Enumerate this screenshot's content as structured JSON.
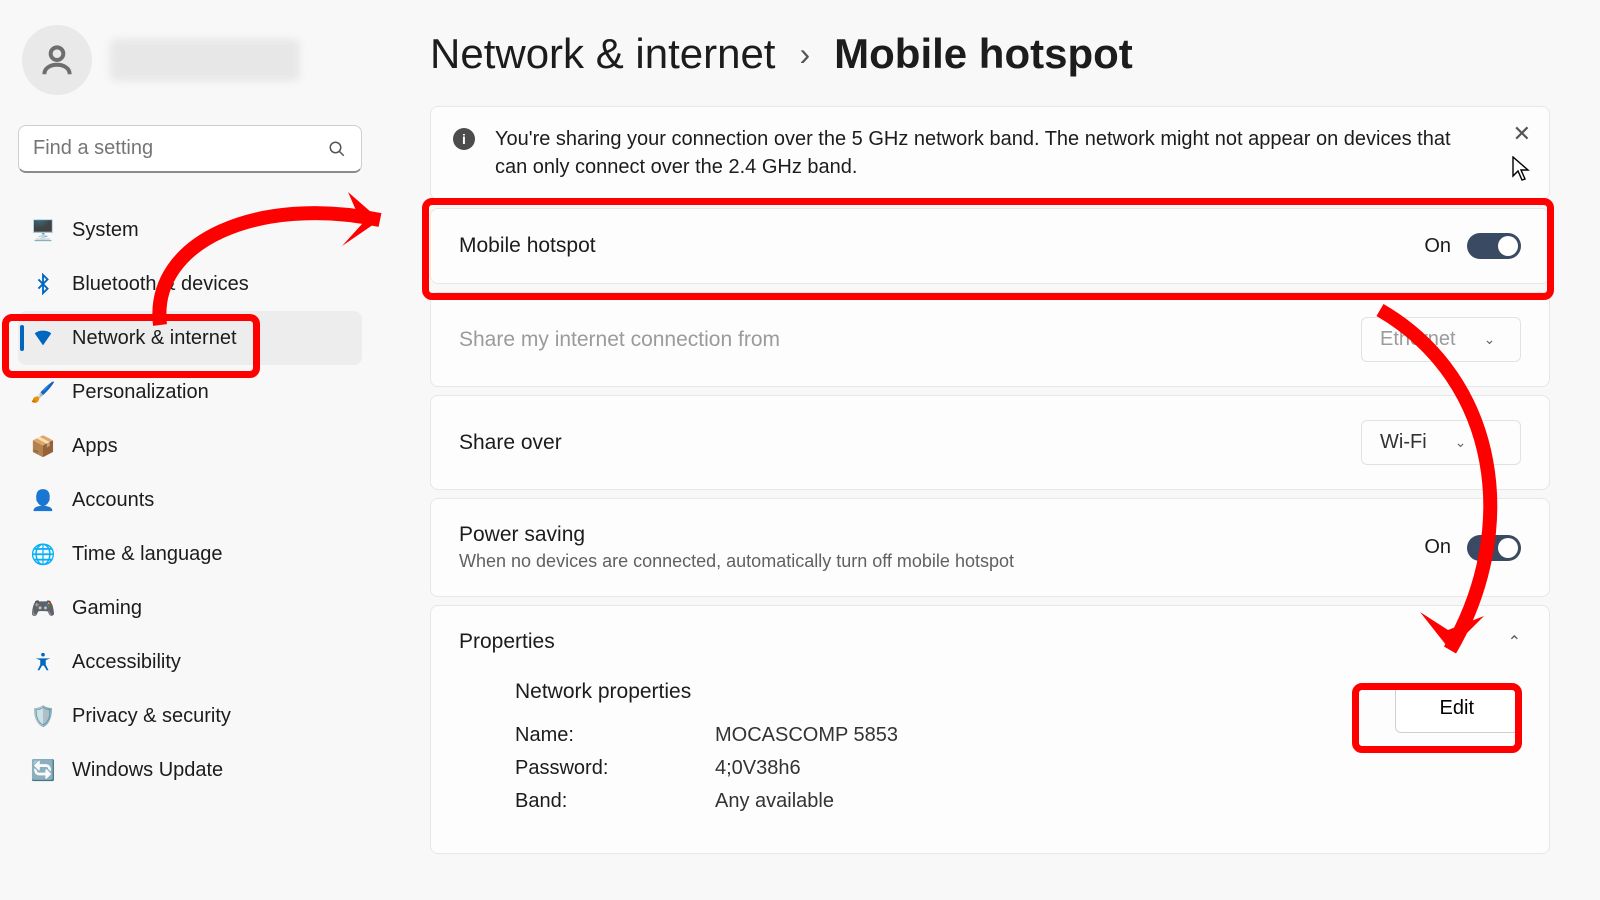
{
  "search": {
    "placeholder": "Find a setting"
  },
  "nav": {
    "items": [
      {
        "label": "System",
        "icon": "🖥️",
        "name": "nav-system"
      },
      {
        "label": "Bluetooth & devices",
        "icon": "",
        "name": "nav-bluetooth"
      },
      {
        "label": "Network & internet",
        "icon": "",
        "name": "nav-network",
        "active": true
      },
      {
        "label": "Personalization",
        "icon": "🖌️",
        "name": "nav-personalization"
      },
      {
        "label": "Apps",
        "icon": "📦",
        "name": "nav-apps"
      },
      {
        "label": "Accounts",
        "icon": "👤",
        "name": "nav-accounts"
      },
      {
        "label": "Time & language",
        "icon": "🌐",
        "name": "nav-time-language"
      },
      {
        "label": "Gaming",
        "icon": "🎮",
        "name": "nav-gaming"
      },
      {
        "label": "Accessibility",
        "icon": "",
        "name": "nav-accessibility"
      },
      {
        "label": "Privacy & security",
        "icon": "🛡️",
        "name": "nav-privacy"
      },
      {
        "label": "Windows Update",
        "icon": "🔄",
        "name": "nav-update"
      }
    ]
  },
  "breadcrumb": {
    "parent": "Network & internet",
    "sep": "›",
    "leaf": "Mobile hotspot"
  },
  "info": {
    "text": "You're sharing your connection over the 5 GHz network band. The network might not appear on devices that can only connect over the 2.4 GHz band."
  },
  "hotspot": {
    "label": "Mobile hotspot",
    "state": "On"
  },
  "share_from": {
    "label": "Share my internet connection from",
    "value": "Ethernet"
  },
  "share_over": {
    "label": "Share over",
    "value": "Wi-Fi"
  },
  "power": {
    "label": "Power saving",
    "sub": "When no devices are connected, automatically turn off mobile hotspot",
    "state": "On"
  },
  "properties": {
    "title": "Properties",
    "section": "Network properties",
    "edit": "Edit",
    "name_k": "Name:",
    "name_v": "MOCASCOMP 5853",
    "pass_k": "Password:",
    "pass_v": "4;0V38h6",
    "band_k": "Band:",
    "band_v": "Any available"
  }
}
